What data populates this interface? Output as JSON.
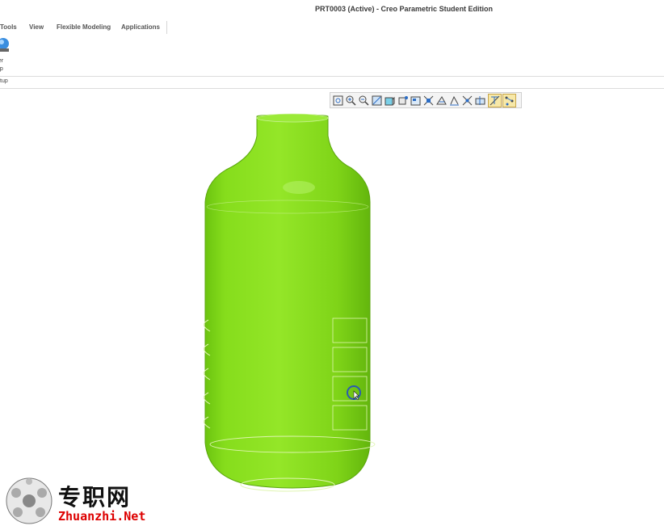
{
  "window": {
    "title": "PRT0003 (Active) - Creo Parametric Student Edition"
  },
  "menubar": {
    "items": [
      "Tools",
      "View",
      "Flexible Modeling",
      "Applications"
    ]
  },
  "ribbon": {
    "button_label_1": "der",
    "button_label_2": "tup",
    "group_label": "tup"
  },
  "graphics_toolbar": {
    "buttons": [
      "refit-icon",
      "zoom-in-icon",
      "zoom-out-icon",
      "repaint-icon",
      "display-style-icon",
      "saved-orientations-icon",
      "view-manager-icon",
      "perspective-icon",
      "datum-display-icon",
      "annotation-display-icon",
      "spin-center-icon",
      "datum-planes-icon",
      "datum-axes-icon",
      "datum-points-icon",
      "coordinate-systems-icon"
    ]
  },
  "model": {
    "name": "bottle",
    "color": "#86e01a",
    "edge_color": "#dff5b0"
  },
  "watermark": {
    "chinese": "专职网",
    "english": "Zhuanzhi.Net"
  },
  "colors": {
    "accent_red": "#dd0000",
    "active_button": "#f7e8a8"
  }
}
